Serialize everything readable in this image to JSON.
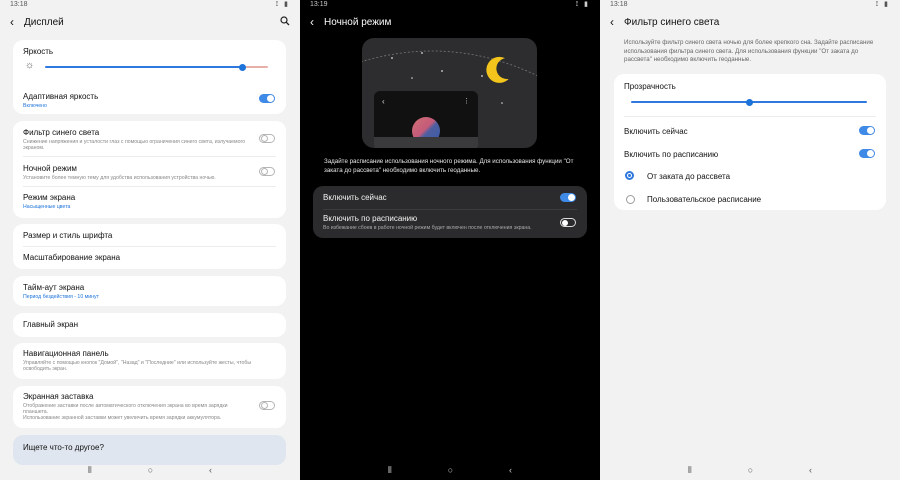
{
  "colors": {
    "accent": "#3f8ae6",
    "link": "#1c73d9",
    "bg_light": "#f2f2f2",
    "bg_dark": "#000000"
  },
  "display": {
    "status": {
      "time": "13:18",
      "icons": "⟟ ▮"
    },
    "header": {
      "title": "Дисплей",
      "back_icon": "‹",
      "search_icon": "⌕"
    },
    "brightness": {
      "label": "Яркость",
      "sun_icon": "☼",
      "level": 0.9
    },
    "adaptive": {
      "title": "Адаптивная яркость",
      "sub": "Включено",
      "on": true
    },
    "blue_filter": {
      "title": "Фильтр синего света",
      "sub": "Снижение напряжения и усталости глаз с помощью ограничения синего света, излучаемого экраном.",
      "on": false
    },
    "night_mode": {
      "title": "Ночной режим",
      "sub": "Установите более темную тему для удобства использования устройства ночью.",
      "on": false
    },
    "screen_mode": {
      "title": "Режим экрана",
      "sub": "Насыщенные цвета"
    },
    "font": {
      "title": "Размер и стиль шрифта"
    },
    "zoom": {
      "title": "Масштабирование экрана"
    },
    "timeout": {
      "title": "Тайм-аут экрана",
      "sub": "Период бездействия - 10 минут"
    },
    "home": {
      "title": "Главный экран"
    },
    "navbar": {
      "title": "Навигационная панель",
      "sub": "Управляйте с помощью кнопок \"Домой\", \"Назад\" и \"Последние\" или используйте жесты, чтобы освободить экран."
    },
    "screensaver": {
      "title": "Экранная заставка",
      "sub1": "Отображение заставки после автоматического отключения экрана во время зарядки планшета.",
      "sub2": "Использование экранной заставки может увеличить время зарядки аккумулятора.",
      "on": false
    },
    "search_prompt": {
      "title": "Ищете что-то другое?"
    }
  },
  "night": {
    "status": {
      "time": "13:19",
      "icons": "⟟ ▮"
    },
    "header": {
      "title": "Ночной режим",
      "back_icon": "‹"
    },
    "description": "Задайте расписание использования ночного режима. Для использования функции \"От заката до рассвета\" необходимо включить геоданные.",
    "enable_now": {
      "title": "Включить сейчас",
      "on": true
    },
    "schedule": {
      "title": "Включить по расписанию",
      "sub": "Во избежание сбоев в работе ночной режим будет включен после отключения экрана.",
      "on": false
    },
    "preview": {
      "back_icon": "‹",
      "menu_icon": "⋮",
      "moon_icon": "crescent-moon"
    }
  },
  "bluefilter": {
    "status": {
      "time": "13:18",
      "icons": "⟟ ▮"
    },
    "header": {
      "title": "Фильтр синего света",
      "back_icon": "‹"
    },
    "description": "Используйте фильтр синего света ночью для более крепкого сна. Задайте расписание использования фильтра синего света. Для использования функции \"От заката до рассвета\" необходимо включить геоданные.",
    "opacity": {
      "label": "Прозрачность",
      "level": 0.5
    },
    "enable_now": {
      "title": "Включить сейчас",
      "on": true
    },
    "schedule": {
      "title": "Включить по расписанию",
      "on": true
    },
    "options": [
      {
        "label": "От заката до рассвета",
        "selected": true
      },
      {
        "label": "Пользовательское расписание",
        "selected": false
      }
    ]
  },
  "nav": {
    "recent": "⦀",
    "home": "○",
    "back": "‹"
  }
}
